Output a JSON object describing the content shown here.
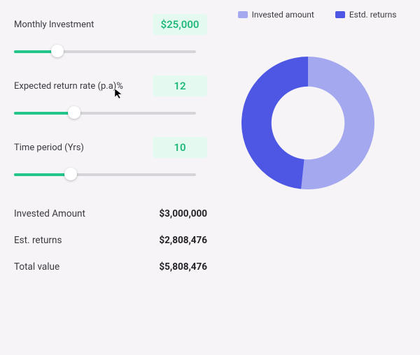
{
  "params": {
    "monthly_investment": {
      "label": "Monthly Investment",
      "display": "$25,000",
      "fill_pct": 24
    },
    "expected_return": {
      "label": "Expected return rate (p.a)%",
      "display": "12",
      "fill_pct": 33
    },
    "time_period": {
      "label": "Time period (Yrs)",
      "display": "10",
      "fill_pct": 31
    }
  },
  "results": {
    "invested": {
      "label": "Invested Amount",
      "value": "$3,000,000"
    },
    "returns": {
      "label": "Est. returns",
      "value": "$2,808,476"
    },
    "total": {
      "label": "Total value",
      "value": "$5,808,476"
    }
  },
  "legend": {
    "invested": {
      "label": "Invested amount",
      "color": "#a4a9ef"
    },
    "returns": {
      "label": "Estd. returns",
      "color": "#4e57e4"
    }
  },
  "chart_data": {
    "type": "pie",
    "title": "",
    "series": [
      {
        "name": "Invested amount",
        "value": 3000000,
        "color": "#a4a9ef"
      },
      {
        "name": "Estd. returns",
        "value": 2808476,
        "color": "#4e57e4"
      }
    ],
    "donut_hole_pct": 55,
    "start_angle_deg": -90
  }
}
